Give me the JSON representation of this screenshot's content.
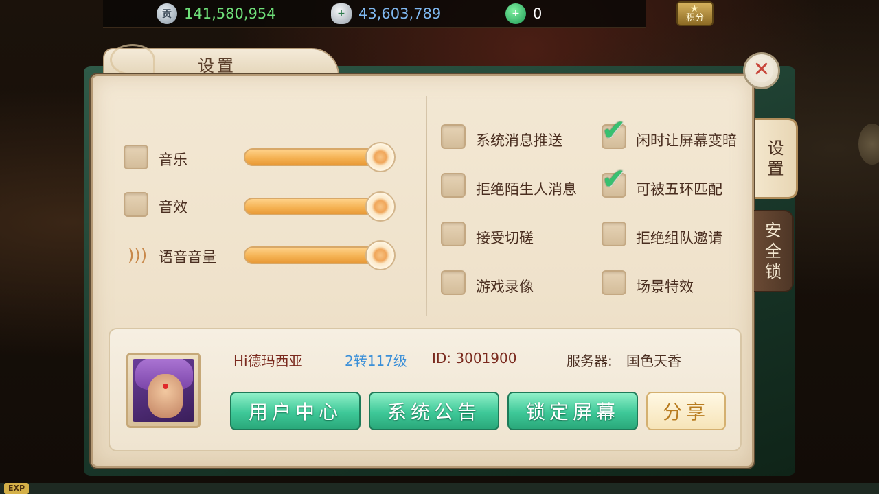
{
  "currencies": {
    "gong": {
      "icon": "gong-coin-icon",
      "glyph": "贡",
      "value": "141,580,954",
      "color": "#6fe07a"
    },
    "silver": {
      "icon": "silver-ingot-icon",
      "glyph": "+",
      "value": "43,603,789",
      "color": "#7fb8f0"
    },
    "jade": {
      "icon": "jade-coin-icon",
      "glyph": "+",
      "value": "0",
      "color": "#ffffff"
    }
  },
  "jifen": {
    "label": "积分",
    "icon": "star-icon"
  },
  "panel": {
    "title": "设置",
    "close_icon": "close-icon",
    "close_glyph": "✕"
  },
  "side_tabs": [
    {
      "label": "设\n置",
      "active": true
    },
    {
      "label": "安\n全\n锁",
      "active": false
    }
  ],
  "left_settings": [
    {
      "label": "音乐",
      "checked": false,
      "slider_level": 1.0
    },
    {
      "label": "音效",
      "checked": false,
      "slider_level": 1.0
    },
    {
      "label": "语音音量",
      "icon": "voice-volume-icon",
      "slider_level": 1.0
    }
  ],
  "right_options": [
    {
      "label": "系统消息推送",
      "checked": false
    },
    {
      "label": "闲时让屏幕变暗",
      "checked": true
    },
    {
      "label": "拒绝陌生人消息",
      "checked": false
    },
    {
      "label": "可被五环匹配",
      "checked": true
    },
    {
      "label": "接受切磋",
      "checked": false
    },
    {
      "label": "拒绝组队邀请",
      "checked": false
    },
    {
      "label": "游戏录像",
      "checked": false
    },
    {
      "label": "场景特效",
      "checked": false
    }
  ],
  "player": {
    "name": "Hi德玛西亚",
    "level": "2转117级",
    "id": "ID: 3001900",
    "server_label": "服务器:",
    "server": "国色天香"
  },
  "buttons": {
    "user_center": "用户中心",
    "announcement": "系统公告",
    "lock_screen": "锁定屏幕",
    "share": "分享"
  },
  "exp_label": "EXP",
  "colors": {
    "check": "#38c070",
    "level": "#3a8fd8",
    "text": "#4a2e20",
    "name": "#7a2a1e"
  }
}
